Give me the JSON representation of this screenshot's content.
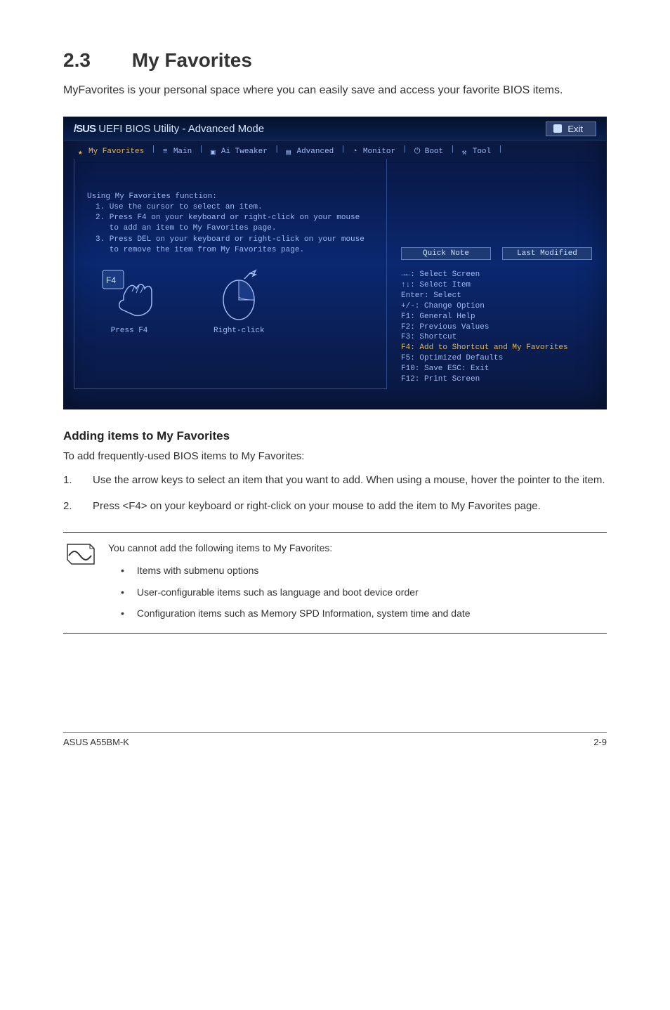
{
  "section": {
    "num": "2.3",
    "title": "My Favorites"
  },
  "intro": "MyFavorites is your personal space where you can easily save and access your favorite BIOS items.",
  "bios": {
    "title_brand": "/SUS",
    "title_rest": "UEFI BIOS Utility - Advanced Mode",
    "exit": "Exit",
    "tabs": [
      {
        "label": "My Favorites",
        "icon": "star-icon",
        "active": true
      },
      {
        "label": "Main",
        "icon": "list-icon"
      },
      {
        "label": "Ai Tweaker",
        "icon": "chip-icon"
      },
      {
        "label": "Advanced",
        "icon": "adv-icon"
      },
      {
        "label": "Monitor",
        "icon": "mon-icon"
      },
      {
        "label": "Boot",
        "icon": "power-icon"
      },
      {
        "label": "Tool",
        "icon": "tool-icon"
      }
    ],
    "func_head": "Using My Favorites function:",
    "func_lines": [
      "1. Use the cursor to select an item.",
      "2. Press F4 on your keyboard or right-click on your mouse",
      "   to add an item to My Favorites page.",
      "3. Press DEL on your keyboard or right-click on your mouse",
      "   to remove the item from My Favorites page."
    ],
    "illus": {
      "f4_key": "F4",
      "press_f4": "Press F4",
      "right_click": "Right-click"
    },
    "side_buttons": {
      "quick_note": "Quick Note",
      "last_modified": "Last Modified"
    },
    "legend": [
      {
        "t": "→←: Select Screen"
      },
      {
        "t": "↑↓: Select Item"
      },
      {
        "t": "Enter: Select"
      },
      {
        "t": "+/-: Change Option"
      },
      {
        "t": "F1: General Help"
      },
      {
        "t": "F2: Previous Values"
      },
      {
        "t": "F3: Shortcut"
      },
      {
        "t": "F4: Add to Shortcut and My Favorites",
        "g": true
      },
      {
        "t": "F5: Optimized Defaults"
      },
      {
        "t": "F10: Save  ESC: Exit"
      },
      {
        "t": "F12: Print Screen"
      }
    ]
  },
  "sub": "Adding items to My Favorites",
  "lead": "To add frequently-used BIOS items to My Favorites:",
  "steps": [
    {
      "n": "1.",
      "t": "Use the arrow keys to select an item that you want to add. When using a mouse, hover the pointer to the item."
    },
    {
      "n": "2.",
      "t": "Press <F4> on your keyboard or right-click on your mouse to add the item to My Favorites page."
    }
  ],
  "note": {
    "lead": "You cannot add the following items to My Favorites:",
    "items": [
      "Items with submenu options",
      "User-configurable items such as language and boot device order",
      "Configuration items such as Memory SPD Information, system time and date"
    ]
  },
  "footer": {
    "left": "ASUS A55BM-K",
    "right": "2-9"
  }
}
